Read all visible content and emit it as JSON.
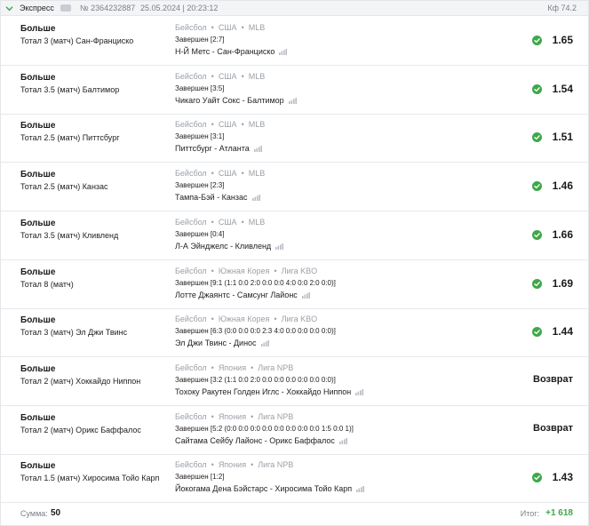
{
  "header": {
    "type_label": "Экспресс",
    "number": "№ 2364232887",
    "date": "25.05.2024 | 20:23:12",
    "coef": "Кф 74.2"
  },
  "colors": {
    "success": "#3ea84a",
    "muted": "#9aa0a7",
    "border": "#e6e8eb"
  },
  "icons": {
    "check": "check-circle-icon",
    "stats": "stats-bars-icon",
    "collapse": "chevron-down-icon"
  },
  "bets": [
    {
      "type": "Больше",
      "market": "Тотал 3 (матч) Сан-Франциско",
      "sport": "Бейсбол",
      "country": "США",
      "league": "MLB",
      "status": "Завершен [2:7]",
      "teams": "Н-Й Метс - Сан-Франциско",
      "result": "1.65"
    },
    {
      "type": "Больше",
      "market": "Тотал 3.5 (матч) Балтимор",
      "sport": "Бейсбол",
      "country": "США",
      "league": "MLB",
      "status": "Завершен [3:5]",
      "teams": "Чикаго Уайт Сокс - Балтимор",
      "result": "1.54"
    },
    {
      "type": "Больше",
      "market": "Тотал 2.5 (матч) Питтсбург",
      "sport": "Бейсбол",
      "country": "США",
      "league": "MLB",
      "status": "Завершен [3:1]",
      "teams": "Питтсбург - Атланта",
      "result": "1.51"
    },
    {
      "type": "Больше",
      "market": "Тотал 2.5 (матч) Канзас",
      "sport": "Бейсбол",
      "country": "США",
      "league": "MLB",
      "status": "Завершен [2:3]",
      "teams": "Тампа-Бэй - Канзас",
      "result": "1.46"
    },
    {
      "type": "Больше",
      "market": "Тотал 3.5 (матч) Кливленд",
      "sport": "Бейсбол",
      "country": "США",
      "league": "MLB",
      "status": "Завершен [0:4]",
      "teams": "Л-А Эйнджелс - Кливленд",
      "result": "1.66"
    },
    {
      "type": "Больше",
      "market": "Тотал 8 (матч)",
      "sport": "Бейсбол",
      "country": "Южная Корея",
      "league": "Лига KBO",
      "status": "Завершен [9:1 (1:1 0:0 2:0 0:0 0:0 4:0 0:0 2:0 0:0)]",
      "teams": "Лотте Джаянтс - Самсунг Лайонс",
      "result": "1.69"
    },
    {
      "type": "Больше",
      "market": "Тотал 3 (матч) Эл Джи Твинс",
      "sport": "Бейсбол",
      "country": "Южная Корея",
      "league": "Лига KBO",
      "status": "Завершен [6:3 (0:0 0:0 0:0 2:3 4:0 0:0 0:0 0:0 0:0)]",
      "teams": "Эл Джи Твинс - Динос",
      "result": "1.44"
    },
    {
      "type": "Больше",
      "market": "Тотал 2 (матч) Хоккайдо Ниппон",
      "sport": "Бейсбол",
      "country": "Япония",
      "league": "Лига NPB",
      "status": "Завершен [3:2 (1:1 0:0 2:0 0:0 0:0 0:0 0:0 0:0 0:0)]",
      "teams": "Тохоку Ракутен Голден Иглс - Хоккайдо Ниппон",
      "result": "Возврат"
    },
    {
      "type": "Больше",
      "market": "Тотал 2 (матч) Орикс Баффалос",
      "sport": "Бейсбол",
      "country": "Япония",
      "league": "Лига NPB",
      "status": "Завершен [5:2 (0:0 0:0 0:0 0:0 0:0 0:0 0:0 0:0 1:5 0:0 1)]",
      "teams": "Сайтама Сейбу Лайонс - Орикс Баффалос",
      "result": "Возврат"
    },
    {
      "type": "Больше",
      "market": "Тотал 1.5 (матч) Хиросима Тойо Карп",
      "sport": "Бейсбол",
      "country": "Япония",
      "league": "Лига NPB",
      "status": "Завершен [1:2]",
      "teams": "Йокогама Дена Бэйстарс - Хиросима Тойо Карп",
      "result": "1.43"
    }
  ],
  "footer": {
    "sum_label": "Сумма:",
    "sum_value": "50",
    "total_label": "Итог:",
    "total_value": "+1 618"
  }
}
